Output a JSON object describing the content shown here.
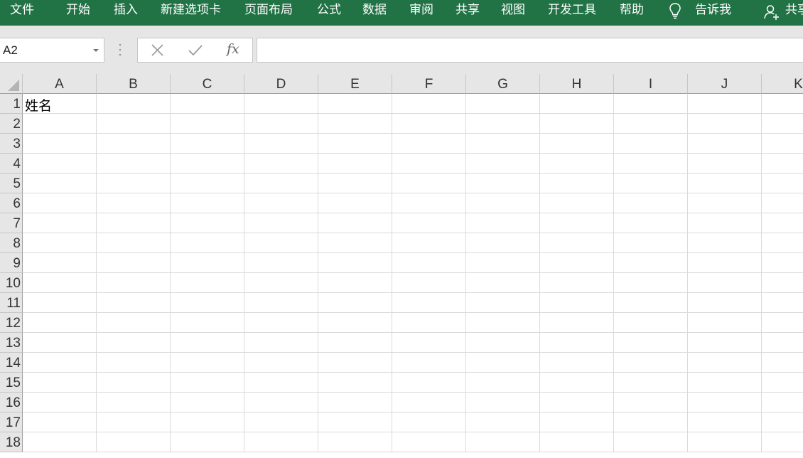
{
  "ribbon": {
    "tabs": [
      "文件",
      "开始",
      "插入",
      "新建选项卡",
      "页面布局",
      "公式",
      "数据",
      "审阅",
      "共享",
      "视图",
      "开发工具",
      "帮助"
    ],
    "tell_me": "告诉我",
    "share": "共享",
    "background": "#217346"
  },
  "formula_bar": {
    "name_box": "A2",
    "cancel_icon": "x-icon",
    "enter_icon": "checkmark-icon",
    "fx_label": "fx",
    "formula_value": ""
  },
  "sheet": {
    "columns": [
      "A",
      "B",
      "C",
      "D",
      "E",
      "F",
      "G",
      "H",
      "I",
      "J",
      "K"
    ],
    "rows": [
      "1",
      "2",
      "3",
      "4",
      "5",
      "6",
      "7",
      "8",
      "9",
      "10",
      "11",
      "12",
      "13",
      "14",
      "15",
      "16",
      "17",
      "18"
    ],
    "cell_A1": "姓名"
  }
}
